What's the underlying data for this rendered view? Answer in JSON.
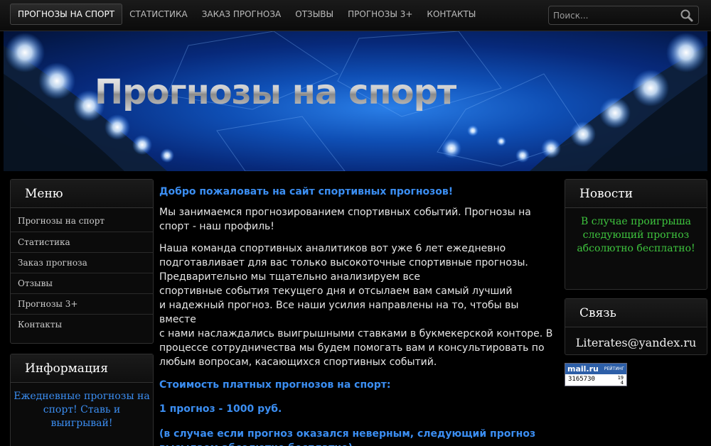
{
  "nav": {
    "items": [
      {
        "label": "ПРОГНОЗЫ НА СПОРТ",
        "active": true
      },
      {
        "label": "СТАТИСТИКА"
      },
      {
        "label": "ЗАКАЗ ПРОГНОЗА"
      },
      {
        "label": "ОТЗЫВЫ"
      },
      {
        "label": "ПРОГНОЗЫ 3+"
      },
      {
        "label": "КОНТАКТЫ"
      }
    ],
    "search_placeholder": "Поиск...",
    "search_icon": "search-icon"
  },
  "banner": {
    "title": "Прогнозы на спорт"
  },
  "menu": {
    "title": "Меню",
    "items": [
      {
        "label": "Прогнозы на спорт"
      },
      {
        "label": "Статистика"
      },
      {
        "label": "Заказ прогноза"
      },
      {
        "label": "Отзывы"
      },
      {
        "label": "Прогнозы 3+"
      },
      {
        "label": "Контакты"
      }
    ]
  },
  "info": {
    "title": "Информация",
    "text": "Ежедневные прогнозы на спорт! Ставь и выигрывай!"
  },
  "main": {
    "heading": "Добро пожаловать на сайт спортивных прогнозов!",
    "p1": "Мы занимаемся прогнозированием спортивных событий. Прогнозы на спорт - наш профиль!",
    "p2_lines": [
      "Наша команда спортивных аналитиков вот уже 6 лет ежедневно",
      "подготавливает для вас только высокоточные спортивные прогнозы.",
      "Предварительно мы тщательно анализируем все",
      "спортивные события текущего дня и отсылаем вам самый лучший",
      "и надежный прогноз. Все наши усилия направлены на то, чтобы вы вместе",
      "с нами наслаждались выигрышными ставками в букмекерской конторе. В",
      "процессе сотрудничества мы будем помогать вам и консультировать по",
      "любым вопросам, касающихся спортивных событий."
    ],
    "price_title": "Стоимость платных прогнозов на спорт:",
    "price": "1 прогноз - 1000 руб.",
    "note": "(в случае если прогноз оказался неверным, следующий прогноз высылаем абсолютно бесплатно)"
  },
  "news": {
    "title": "Новости",
    "text": "В случае проигрыша следующий прогноз абсолютно бесплатно!"
  },
  "contact": {
    "title": "Связь",
    "email": "Literates@yandex.ru"
  },
  "counter": {
    "brand": "mail.ru",
    "tag": "РЕЙТИНГ",
    "value": "3165730",
    "small1": "19",
    "small2": "4"
  },
  "colors": {
    "accent_blue": "#3b8ef2",
    "news_green": "#3ec53e",
    "background": "#000000"
  }
}
